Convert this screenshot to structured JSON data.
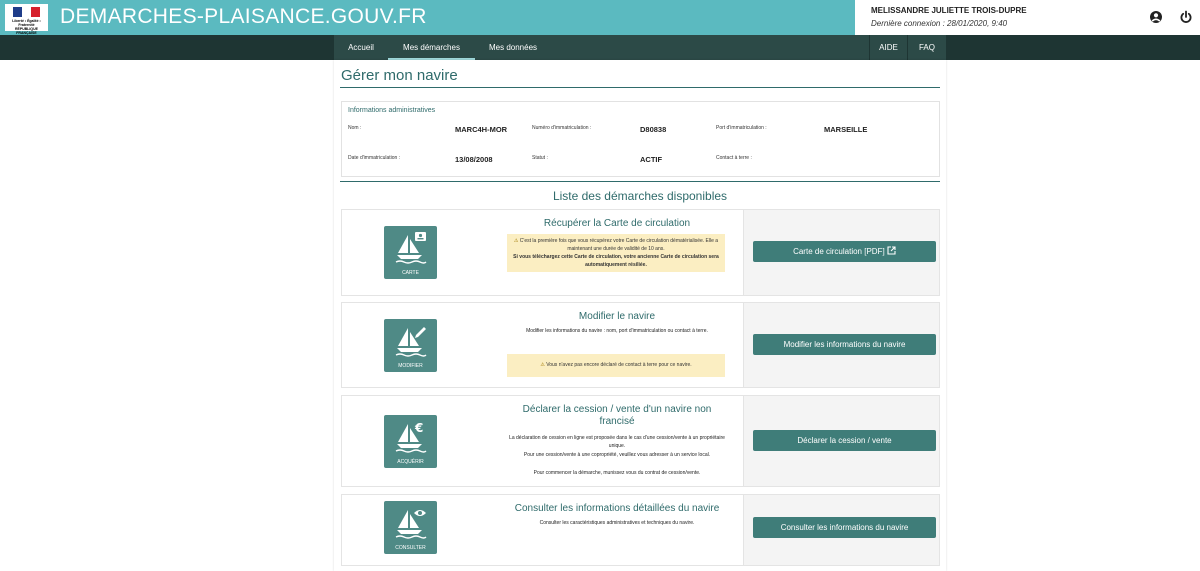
{
  "header": {
    "logo_text": "Liberté • Égalité • Fraternité RÉPUBLIQUE FRANÇAISE",
    "site_title": "DEMARCHES-PLAISANCE.GOUV.FR",
    "user_name": "MELISSANDRE JULIETTE TROIS-DUPRE",
    "last_connection": "Dernière connexion : 28/01/2020, 9:40"
  },
  "nav": {
    "items": [
      {
        "label": "Accueil"
      },
      {
        "label": "Mes démarches"
      },
      {
        "label": "Mes données"
      }
    ],
    "aide": "AIDE",
    "faq": "FAQ",
    "active": "Mes démarches"
  },
  "page": {
    "title": "Gérer mon navire",
    "admin": {
      "heading": "Informations administratives",
      "fields": [
        {
          "label": "Nom :",
          "value": "MARC4H-MOR"
        },
        {
          "label": "Numéro d'immatriculation :",
          "value": "D80838"
        },
        {
          "label": "Port d'immatriculation :",
          "value": "MARSEILLE"
        },
        {
          "label": "Date d'immatriculation :",
          "value": "13/08/2008"
        },
        {
          "label": "Statut :",
          "value": "ACTIF"
        },
        {
          "label": "Contact à terre :",
          "value": ""
        }
      ]
    },
    "list_title": "Liste des démarches disponibles",
    "cards": [
      {
        "tile_label": "CARTE",
        "title": "Récupérer la Carte de circulation",
        "warning_line1": "C'est la première fois que vous récupérez votre Carte de circulation dématérialisée. Elle a maintenant une durée de validité de 10 ans.",
        "warning_line2": "Si vous téléchargez cette Carte de circulation, votre ancienne Carte de circulation sera automatiquement résiliée.",
        "button": "Carte de circulation [PDF]"
      },
      {
        "tile_label": "MODIFIER",
        "title": "Modifier le navire",
        "text": "Modifier les informations du navire : nom, port d'immatriculation ou contact à terre.",
        "warning": "Vous n'avez pas encore déclaré de contact à terre pour ce navire.",
        "button": "Modifier les informations du navire"
      },
      {
        "tile_label": "ACQUÉRIR",
        "title": "Déclarer la cession / vente d'un navire non francisé",
        "text1": "La déclaration de cession en ligne est proposée dans le cas d'une cession/vente à un propriétaire unique.",
        "text2": "Pour une cession/vente à une copropriété, veuillez vous adresser à un service local.",
        "text3": "Pour commencer la démarche, munissez vous du contrat de cession/vente.",
        "button": "Déclarer la cession / vente"
      },
      {
        "tile_label": "CONSULTER",
        "title": "Consulter les informations détaillées du navire",
        "text": "Consulter les caractéristiques administratives et techniques du navire.",
        "button": "Consulter les informations du navire"
      }
    ]
  },
  "colors": {
    "brand": "#5bbac0",
    "nav_dark": "#1e3533",
    "nav": "#2c4a47",
    "accent": "#2f6b6b",
    "button": "#3f7d79",
    "tile": "#4f8a86",
    "warning_bg": "#fbeec2"
  },
  "icons": [
    "user-circle-icon",
    "power-icon",
    "external-link-icon",
    "warning-icon",
    "boat-card-icon",
    "pencil-icon",
    "euro-icon",
    "eye-icon"
  ]
}
